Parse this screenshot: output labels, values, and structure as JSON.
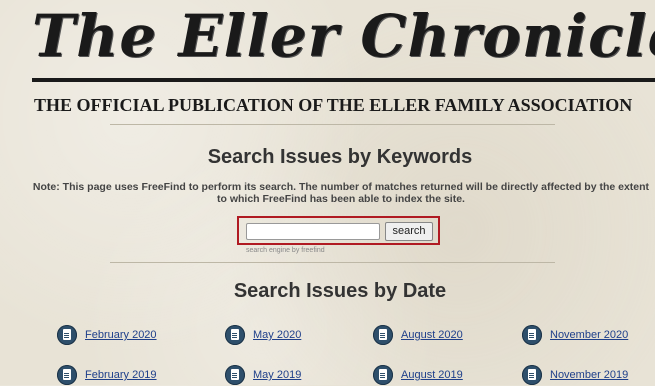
{
  "masthead": {
    "title": "The Eller Chronicles",
    "subtitle": "THE OFFICIAL PUBLICATION OF THE ELLER FAMILY ASSOCIATION"
  },
  "keyword_search": {
    "heading": "Search Issues by Keywords",
    "note_line1": "Note: This page uses FreeFind to perform its search. The number of matches returned will be directly affected by the extent",
    "note_line2": "to which FreeFind has been able to index the site.",
    "input_value": "",
    "button_label": "search",
    "credit": "search engine by freefind"
  },
  "date_search": {
    "heading": "Search Issues by Date",
    "rows": [
      [
        "February 2020",
        "May 2020",
        "August 2020",
        "November 2020"
      ],
      [
        "February 2019",
        "May 2019",
        "August 2019",
        "November 2019"
      ]
    ]
  },
  "colors": {
    "highlight_border": "#b01a22",
    "link": "#1e3f8a",
    "icon": "#2e4f6b"
  }
}
